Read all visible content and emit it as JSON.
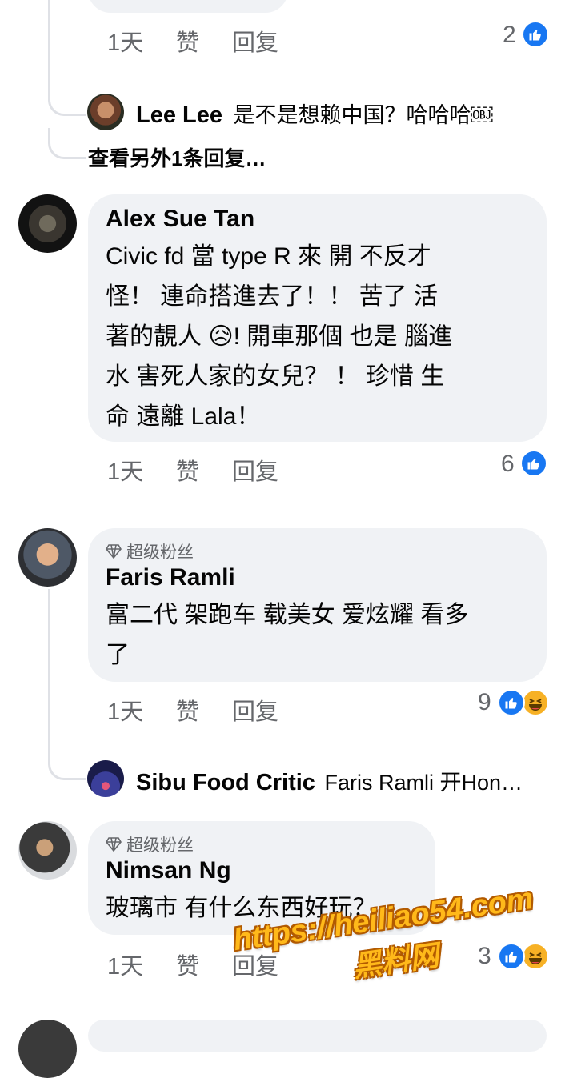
{
  "comments": [
    {
      "actions": {
        "time": "1天",
        "like": "赞",
        "reply": "回复"
      },
      "reaction_count": "2"
    },
    {
      "author": "Alex Sue Tan",
      "lines": [
        "Civic fd 當 type R 來 開 不反才",
        "怪！ 連命搭進去了！！ 苦了 活",
        "著的靚人 😥! 開車那個 也是 腦進",
        "水 害死人家的女兒？ ！ 珍惜 生",
        "命 遠離 Lala！"
      ],
      "actions": {
        "time": "1天",
        "like": "赞",
        "reply": "回复"
      },
      "reaction_count": "6"
    },
    {
      "badge": "超级粉丝",
      "author": "Faris Ramli",
      "lines": [
        "富二代 架跑车 载美女 爱炫耀 看多",
        "了"
      ],
      "actions": {
        "time": "1天",
        "like": "赞",
        "reply": "回复"
      },
      "reaction_count": "9"
    },
    {
      "badge": "超级粉丝",
      "author": "Nimsan Ng",
      "lines": [
        "玻璃市 有什么东西好玩？"
      ],
      "actions": {
        "time": "1天",
        "like": "赞",
        "reply": "回复"
      },
      "reaction_count": "3"
    }
  ],
  "replies": [
    {
      "author": "Lee Lee",
      "text": "是不是想赖中国？哈哈哈￼"
    },
    {
      "author": "Sibu Food Critic",
      "text": "Faris Ramli 开Hon…"
    }
  ],
  "view_more": "查看另外1条回复…",
  "watermark": {
    "url": "https://heiliao54.com",
    "name": "黑料网"
  },
  "colors": {
    "like_blue": "#1877f2",
    "bubble": "#f0f2f5",
    "meta": "#65676b",
    "watermark": "#ffb91a"
  }
}
